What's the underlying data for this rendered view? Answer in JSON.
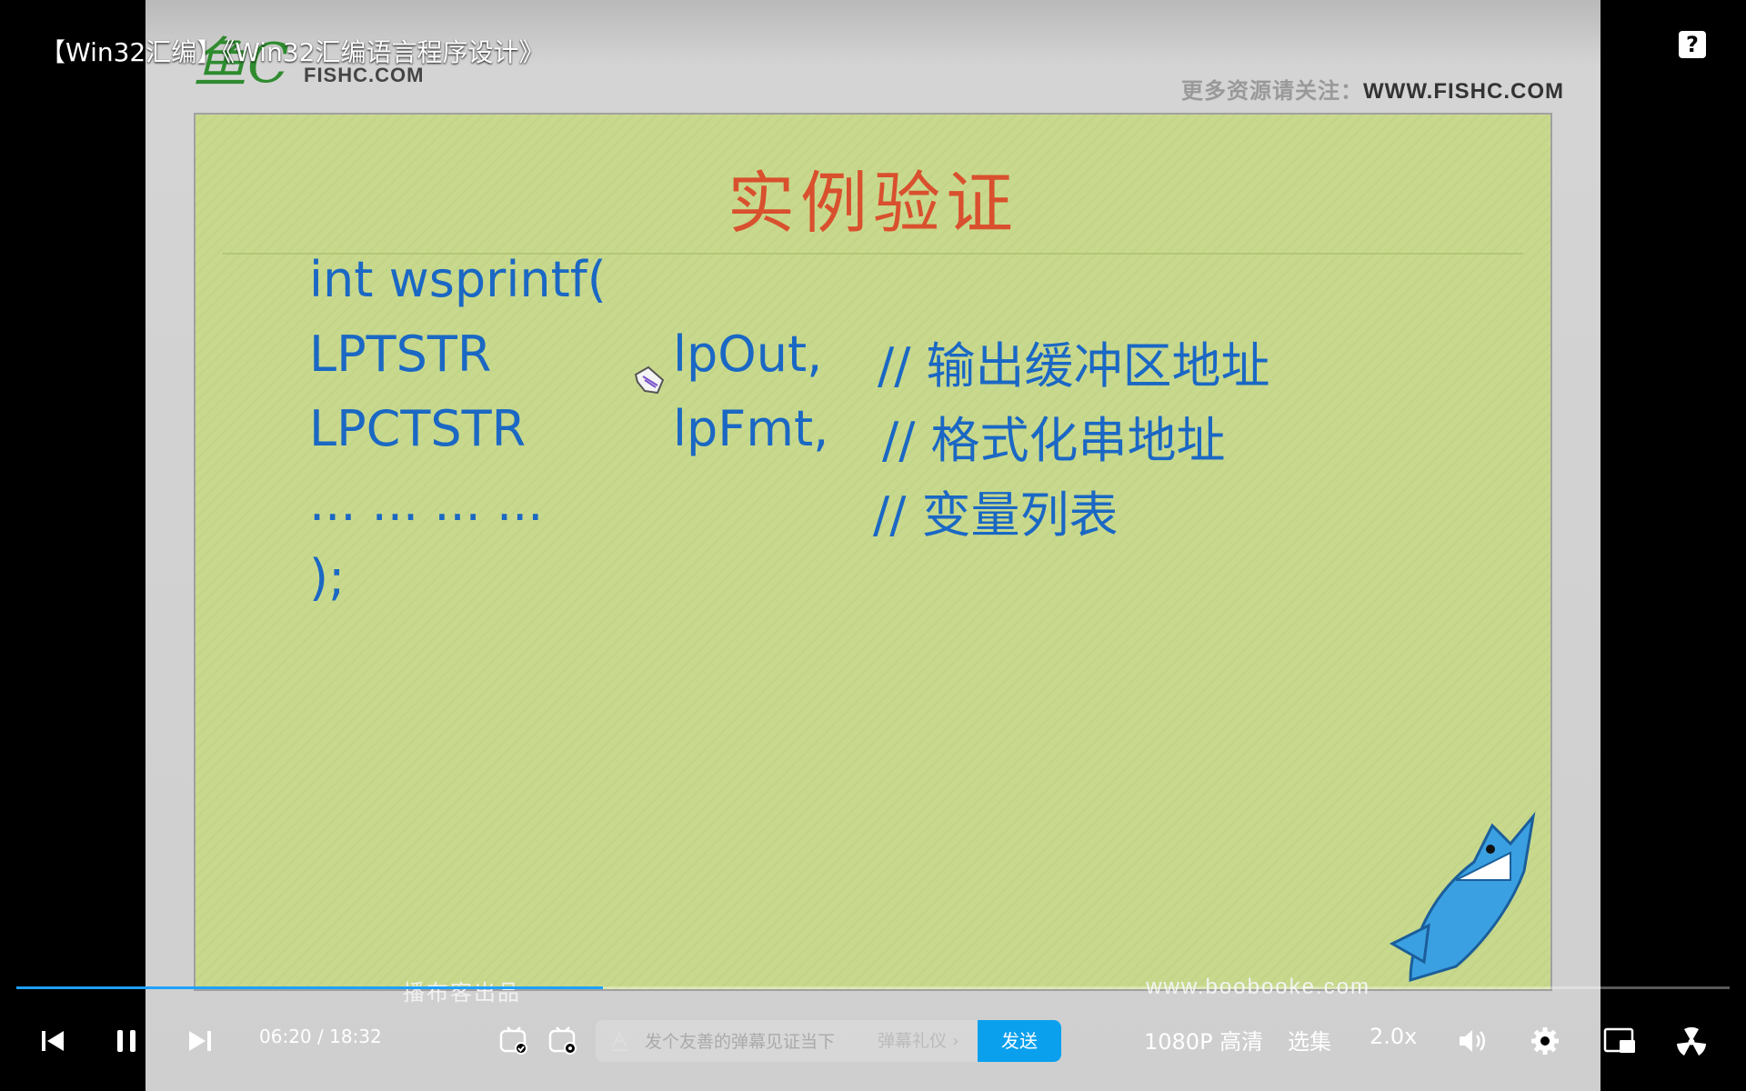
{
  "window": {
    "title": "【Win32汇编】《Win32汇编语言程序设计》"
  },
  "slide": {
    "logo_script": "鱼C",
    "logo_text": "FISHC.COM",
    "header_prefix": "更多资源请关注：",
    "header_site": "WWW.FISHC.COM",
    "title": "实例验证",
    "code_lines": {
      "l1": "int wsprintf(",
      "l2_type": "LPTSTR",
      "l2_param": "lpOut,",
      "l2_comment": "// 输出缓冲区地址",
      "l3_type": "LPCTSTR",
      "l3_param": "lpFmt,",
      "l3_comment": "// 格式化串地址",
      "l4": "... ... ... ...",
      "l4_comment": "// 变量列表",
      "l5": ");"
    },
    "footer_left": "播布客出品",
    "footer_right": "www.boobooke.com"
  },
  "player": {
    "progress": 0.3423,
    "current_time": "06:20",
    "separator": "/",
    "total_time": "18:32",
    "danmaku_placeholder": "发个友善的弹幕见证当下",
    "danmaku_etiquette": "弹幕礼仪 ›",
    "send_label": "发送",
    "quality_label": "1080P 高清",
    "episodes_label": "选集",
    "speed_label": "2.0x",
    "accent_color": "#0aa0ee",
    "icons": [
      "prev-icon",
      "pause-icon",
      "next-icon",
      "danmaku-toggle-icon",
      "danmaku-settings-icon",
      "text-style-icon",
      "volume-icon",
      "settings-icon",
      "pip-icon",
      "fullscreen-icon",
      "help-icon"
    ]
  }
}
